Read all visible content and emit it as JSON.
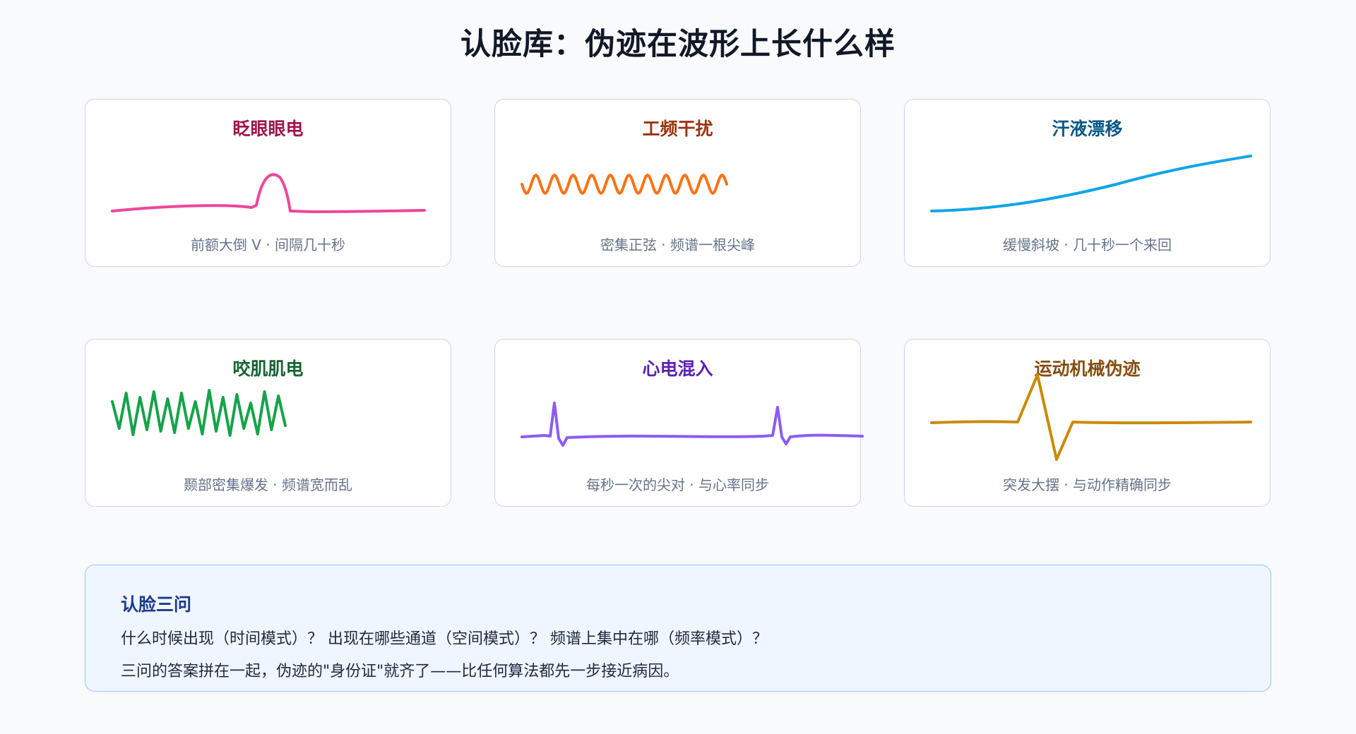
{
  "page_title": "认脸库：伪迹在波形上长什么样",
  "cards": [
    {
      "title": "眨眼眼电",
      "desc": "前额大倒 V · 间隔几十秒",
      "color": "#ec4899",
      "title_color": "#9d174d",
      "wave": "blink"
    },
    {
      "title": "工频干扰",
      "desc": "密集正弦 · 频谱一根尖峰",
      "color": "#f97316",
      "title_color": "#9a3412",
      "wave": "powerline"
    },
    {
      "title": "汗液漂移",
      "desc": "缓慢斜坡 · 几十秒一个来回",
      "color": "#0ea5e9",
      "title_color": "#075985",
      "wave": "drift"
    },
    {
      "title": "咬肌肌电",
      "desc": "颞部密集爆发 · 频谱宽而乱",
      "color": "#16a34a",
      "title_color": "#166534",
      "wave": "emg"
    },
    {
      "title": "心电混入",
      "desc": "每秒一次的尖对 · 与心率同步",
      "color": "#8b5cf6",
      "title_color": "#5b21b6",
      "wave": "ecg"
    },
    {
      "title": "运动机械伪迹",
      "desc": "突发大摆 · 与动作精确同步",
      "color": "#ca8a04",
      "title_color": "#854d0e",
      "wave": "motion"
    }
  ],
  "summary": {
    "title": "认脸三问",
    "line1": "什么时候出现（时间模式）？ 出现在哪些通道（空间模式）？ 频谱上集中在哪（频率模式）？",
    "line2": "三问的答案拼在一起，伪迹的\"身份证\"就齐了——比任何算法都先一步接近病因。"
  }
}
